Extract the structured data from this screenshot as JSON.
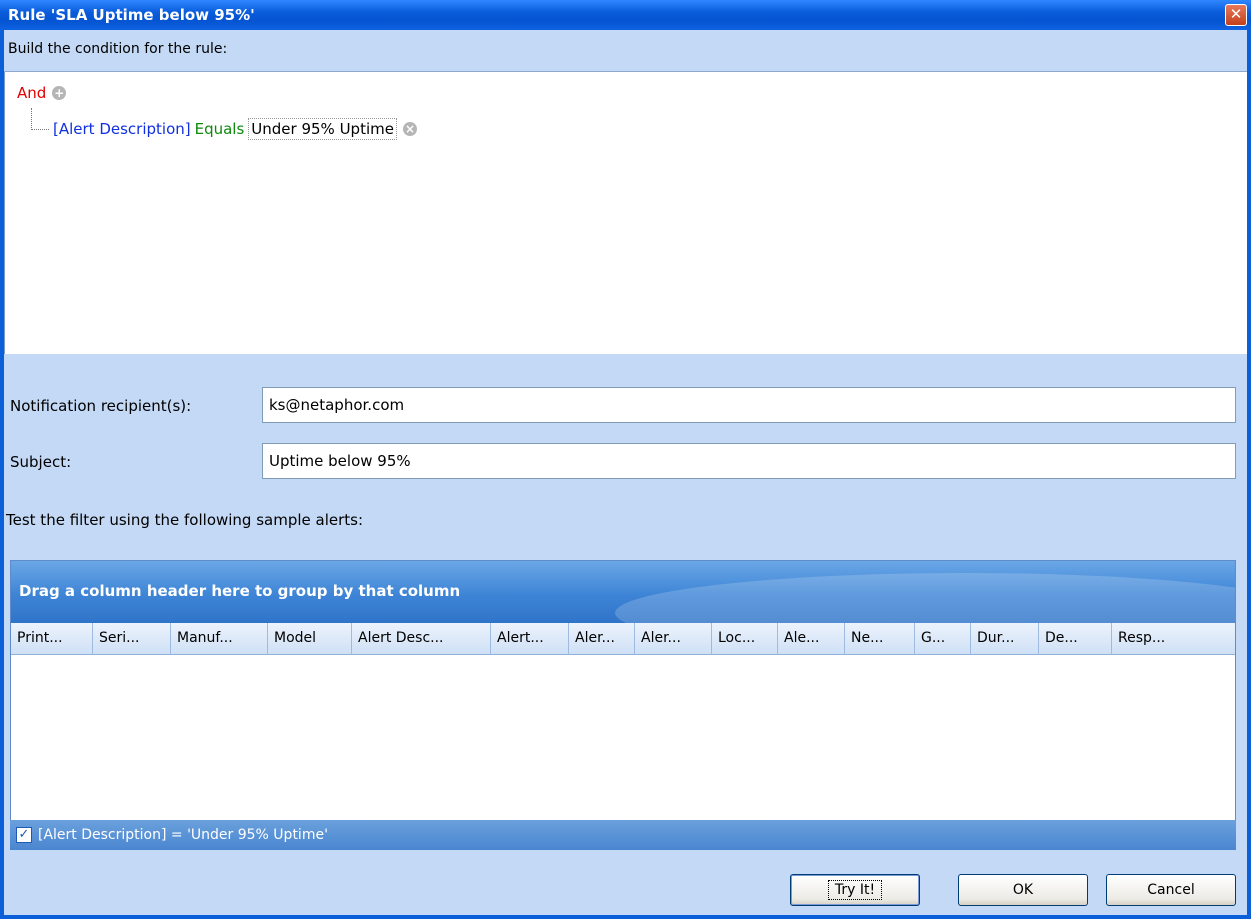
{
  "window": {
    "title": "Rule 'SLA Uptime below 95%'",
    "close_glyph": "✕"
  },
  "condition": {
    "label": "Build the condition for the rule:",
    "group_operator": "And",
    "add_icon": "plus-circle-icon",
    "rule": {
      "field": "[Alert Description]",
      "operator": "Equals",
      "value": "Under 95% Uptime",
      "remove_icon": "remove-circle-icon"
    }
  },
  "form": {
    "recipients_label": "Notification recipient(s):",
    "recipients_value": "ks@netaphor.com",
    "subject_label": "Subject:",
    "subject_value": "Uptime below 95%"
  },
  "test": {
    "label": "Test the filter using the following sample alerts:",
    "group_panel_text": "Drag a column header here to group by that column",
    "columns": [
      "Print...",
      "Seri...",
      "Manuf...",
      "Model",
      "Alert Desc...",
      "Alert...",
      "Aler...",
      "Aler...",
      "Loc...",
      "Ale...",
      "Ne...",
      "G...",
      "Dur...",
      "De...",
      "Resp..."
    ],
    "filter_text": "[Alert Description] = 'Under 95% Uptime'",
    "filter_checked": true
  },
  "buttons": {
    "try": "Try It!",
    "ok": "OK",
    "cancel": "Cancel"
  }
}
